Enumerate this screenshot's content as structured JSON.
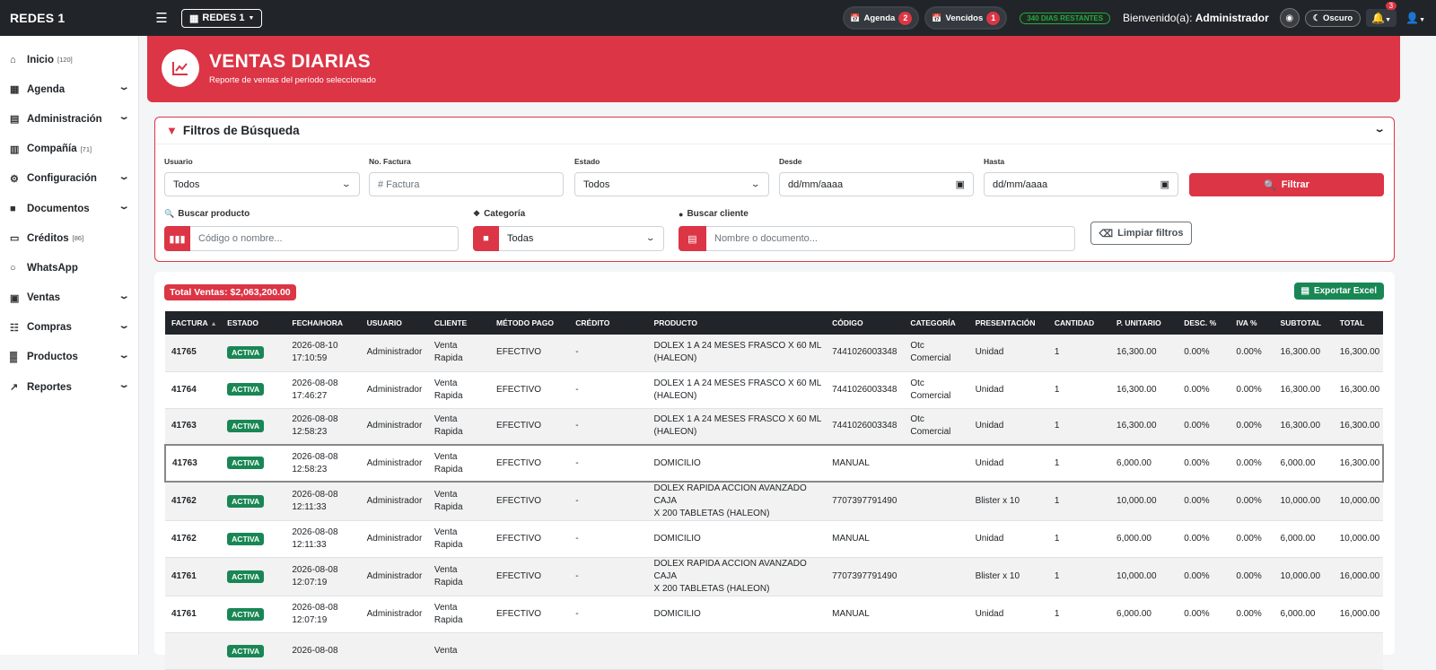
{
  "topbar": {
    "brand": "REDES 1",
    "company_button": "REDES 1",
    "agenda_label": "Agenda",
    "agenda_count": "2",
    "vencidos_label": "Vencidos",
    "vencidos_count": "1",
    "days_remaining": "340 DIAS RESTANTES",
    "welcome_prefix": "Bienvenido(a):",
    "welcome_user": "Administrador",
    "dark_mode_label": "Oscuro",
    "notifications_count": "3"
  },
  "sidebar": {
    "items": [
      {
        "label": "Inicio",
        "count": "[120]",
        "icon": "home-icon",
        "has_chevron": false
      },
      {
        "label": "Agenda",
        "count": "",
        "icon": "calendar-icon",
        "has_chevron": true
      },
      {
        "label": "Administración",
        "count": "",
        "icon": "id-card-icon",
        "has_chevron": true
      },
      {
        "label": "Compañía",
        "count": "[71]",
        "icon": "building-icon",
        "has_chevron": false
      },
      {
        "label": "Configuración",
        "count": "",
        "icon": "cogs-icon",
        "has_chevron": true
      },
      {
        "label": "Documentos",
        "count": "",
        "icon": "folder-icon",
        "has_chevron": true
      },
      {
        "label": "Créditos",
        "count": "[86]",
        "icon": "credit-card-icon",
        "has_chevron": false
      },
      {
        "label": "WhatsApp",
        "count": "",
        "icon": "whatsapp-icon",
        "has_chevron": false
      },
      {
        "label": "Ventas",
        "count": "",
        "icon": "cash-register-icon",
        "has_chevron": true
      },
      {
        "label": "Compras",
        "count": "",
        "icon": "cart-icon",
        "has_chevron": true
      },
      {
        "label": "Productos",
        "count": "",
        "icon": "boxes-icon",
        "has_chevron": true
      },
      {
        "label": "Reportes",
        "count": "",
        "icon": "chart-icon",
        "has_chevron": true
      }
    ]
  },
  "header": {
    "title": "VENTAS DIARIAS",
    "subtitle": "Reporte de ventas del período seleccionado"
  },
  "filters": {
    "title": "Filtros de Búsqueda",
    "usuario_label": "Usuario",
    "usuario_value": "Todos",
    "factura_label": "No. Factura",
    "factura_placeholder": "# Factura",
    "estado_label": "Estado",
    "estado_value": "Todos",
    "desde_label": "Desde",
    "desde_placeholder": "dd/mm/aaaa",
    "hasta_label": "Hasta",
    "hasta_placeholder": "dd/mm/aaaa",
    "filter_button": "Filtrar",
    "producto_label": "Buscar producto",
    "producto_placeholder": "Código o nombre...",
    "categoria_label": "Categoría",
    "categoria_value": "Todas",
    "cliente_label": "Buscar cliente",
    "cliente_placeholder": "Nombre o documento...",
    "clear_button": "Limpiar filtros"
  },
  "results": {
    "total_label": "Total Ventas: $2,063,200.00",
    "export_button": "Exportar Excel",
    "columns": [
      "FACTURA",
      "ESTADO",
      "FECHA/HORA",
      "USUARIO",
      "CLIENTE",
      "MÉTODO PAGO",
      "CRÉDITO",
      "PRODUCTO",
      "CÓDIGO",
      "CATEGORÍA",
      "PRESENTACIÓN",
      "CANTIDAD",
      "P. UNITARIO",
      "DESC. %",
      "IVA %",
      "SUBTOTAL",
      "TOTAL"
    ],
    "rows": [
      {
        "factura": "41765",
        "estado": "ACTIVA",
        "fecha": "2026-08-10",
        "hora": "17:10:59",
        "usuario": "Administrador",
        "cliente1": "Venta",
        "cliente2": "Rapida",
        "metodo": "EFECTIVO",
        "credito": "-",
        "producto1": "DOLEX 1 A 24 MESES FRASCO X 60 ML",
        "producto2": "(HALEON)",
        "codigo": "7441026003348",
        "cat1": "Otc",
        "cat2": "Comercial",
        "presentacion": "Unidad",
        "cantidad": "1",
        "unitario": "16,300.00",
        "desc": "0.00%",
        "iva": "0.00%",
        "subtotal": "16,300.00",
        "total": "16,300.00"
      },
      {
        "factura": "41764",
        "estado": "ACTIVA",
        "fecha": "2026-08-08",
        "hora": "17:46:27",
        "usuario": "Administrador",
        "cliente1": "Venta",
        "cliente2": "Rapida",
        "metodo": "EFECTIVO",
        "credito": "-",
        "producto1": "DOLEX 1 A 24 MESES FRASCO X 60 ML",
        "producto2": "(HALEON)",
        "codigo": "7441026003348",
        "cat1": "Otc",
        "cat2": "Comercial",
        "presentacion": "Unidad",
        "cantidad": "1",
        "unitario": "16,300.00",
        "desc": "0.00%",
        "iva": "0.00%",
        "subtotal": "16,300.00",
        "total": "16,300.00"
      },
      {
        "factura": "41763",
        "estado": "ACTIVA",
        "fecha": "2026-08-08",
        "hora": "12:58:23",
        "usuario": "Administrador",
        "cliente1": "Venta",
        "cliente2": "Rapida",
        "metodo": "EFECTIVO",
        "credito": "-",
        "producto1": "DOLEX 1 A 24 MESES FRASCO X 60 ML",
        "producto2": "(HALEON)",
        "codigo": "7441026003348",
        "cat1": "Otc",
        "cat2": "Comercial",
        "presentacion": "Unidad",
        "cantidad": "1",
        "unitario": "16,300.00",
        "desc": "0.00%",
        "iva": "0.00%",
        "subtotal": "16,300.00",
        "total": "16,300.00"
      },
      {
        "factura": "41763",
        "estado": "ACTIVA",
        "fecha": "2026-08-08",
        "hora": "12:58:23",
        "usuario": "Administrador",
        "cliente1": "Venta",
        "cliente2": "Rapida",
        "metodo": "EFECTIVO",
        "credito": "-",
        "producto1": "DOMICILIO",
        "producto2": "",
        "codigo": "MANUAL",
        "cat1": "",
        "cat2": "",
        "presentacion": "Unidad",
        "cantidad": "1",
        "unitario": "6,000.00",
        "desc": "0.00%",
        "iva": "0.00%",
        "subtotal": "6,000.00",
        "total": "16,300.00"
      },
      {
        "factura": "41762",
        "estado": "ACTIVA",
        "fecha": "2026-08-08",
        "hora": "12:11:33",
        "usuario": "Administrador",
        "cliente1": "Venta",
        "cliente2": "Rapida",
        "metodo": "EFECTIVO",
        "credito": "-",
        "producto1": "DOLEX RAPIDA ACCION AVANZADO CAJA",
        "producto2": "X 200 TABLETAS (HALEON)",
        "codigo": "7707397791490",
        "cat1": "",
        "cat2": "",
        "presentacion": "Blister x 10",
        "cantidad": "1",
        "unitario": "10,000.00",
        "desc": "0.00%",
        "iva": "0.00%",
        "subtotal": "10,000.00",
        "total": "10,000.00"
      },
      {
        "factura": "41762",
        "estado": "ACTIVA",
        "fecha": "2026-08-08",
        "hora": "12:11:33",
        "usuario": "Administrador",
        "cliente1": "Venta",
        "cliente2": "Rapida",
        "metodo": "EFECTIVO",
        "credito": "-",
        "producto1": "DOMICILIO",
        "producto2": "",
        "codigo": "MANUAL",
        "cat1": "",
        "cat2": "",
        "presentacion": "Unidad",
        "cantidad": "1",
        "unitario": "6,000.00",
        "desc": "0.00%",
        "iva": "0.00%",
        "subtotal": "6,000.00",
        "total": "10,000.00"
      },
      {
        "factura": "41761",
        "estado": "ACTIVA",
        "fecha": "2026-08-08",
        "hora": "12:07:19",
        "usuario": "Administrador",
        "cliente1": "Venta",
        "cliente2": "Rapida",
        "metodo": "EFECTIVO",
        "credito": "-",
        "producto1": "DOLEX RAPIDA ACCION AVANZADO CAJA",
        "producto2": "X 200 TABLETAS (HALEON)",
        "codigo": "7707397791490",
        "cat1": "",
        "cat2": "",
        "presentacion": "Blister x 10",
        "cantidad": "1",
        "unitario": "10,000.00",
        "desc": "0.00%",
        "iva": "0.00%",
        "subtotal": "10,000.00",
        "total": "16,000.00"
      },
      {
        "factura": "41761",
        "estado": "ACTIVA",
        "fecha": "2026-08-08",
        "hora": "12:07:19",
        "usuario": "Administrador",
        "cliente1": "Venta",
        "cliente2": "Rapida",
        "metodo": "EFECTIVO",
        "credito": "-",
        "producto1": "DOMICILIO",
        "producto2": "",
        "codigo": "MANUAL",
        "cat1": "",
        "cat2": "",
        "presentacion": "Unidad",
        "cantidad": "1",
        "unitario": "6,000.00",
        "desc": "0.00%",
        "iva": "0.00%",
        "subtotal": "6,000.00",
        "total": "16,000.00"
      },
      {
        "factura": "",
        "estado": "ACTIVA",
        "fecha": "2026-08-08",
        "hora": "",
        "usuario": "",
        "cliente1": "Venta",
        "cliente2": "",
        "metodo": "",
        "credito": "",
        "producto1": "",
        "producto2": "",
        "codigo": "",
        "cat1": "",
        "cat2": "",
        "presentacion": "",
        "cantidad": "",
        "unitario": "",
        "desc": "",
        "iva": "",
        "subtotal": "",
        "total": ""
      }
    ]
  }
}
